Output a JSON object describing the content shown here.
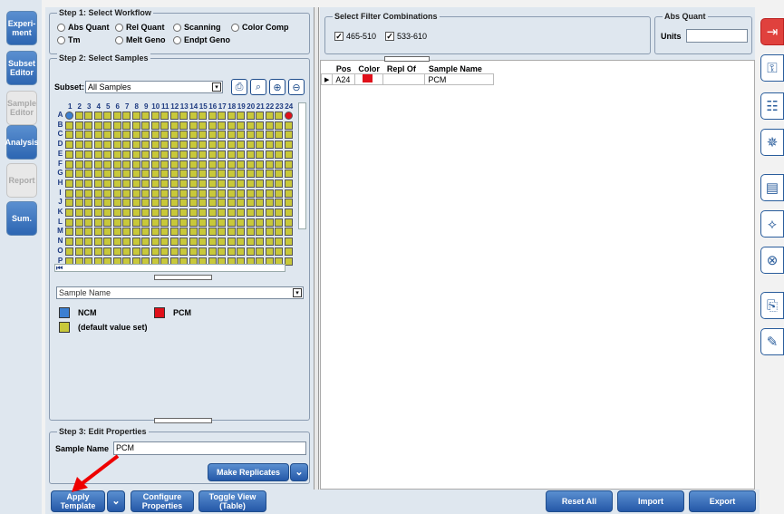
{
  "nav": {
    "experiment": "Experi-\nment",
    "subset_editor": "Subset Editor",
    "sample_editor": "Sample Editor",
    "analysis": "Analysis",
    "report": "Report",
    "summary": "Sum."
  },
  "step1": {
    "title": "Step 1: Select Workflow",
    "options": [
      "Abs Quant",
      "Rel Quant",
      "Scanning",
      "Color Comp",
      "Tm",
      "Melt Geno",
      "Endpt Geno"
    ]
  },
  "filters": {
    "title": "Select Filter Combinations",
    "items": [
      "465-510",
      "533-610"
    ]
  },
  "absquant": {
    "title": "Abs Quant",
    "units_label": "Units",
    "units_value": ""
  },
  "step2": {
    "title": "Step 2: Select Samples",
    "subset_label": "Subset:",
    "subset_value": "All Samples",
    "rows": [
      "A",
      "B",
      "C",
      "D",
      "E",
      "F",
      "G",
      "H",
      "I",
      "J",
      "K",
      "L",
      "M",
      "N",
      "O",
      "P"
    ],
    "cols": [
      "1",
      "2",
      "3",
      "4",
      "5",
      "6",
      "7",
      "8",
      "9",
      "10",
      "11",
      "12",
      "13",
      "14",
      "15",
      "16",
      "17",
      "18",
      "19",
      "20",
      "21",
      "22",
      "23",
      "24"
    ],
    "property_select": "Sample Name",
    "legend": [
      {
        "label": "NCM",
        "color": "#3b7fd1"
      },
      {
        "label": "PCM",
        "color": "#e0101a"
      },
      {
        "label": "(default value set)",
        "color": "#c8c83a"
      }
    ]
  },
  "table": {
    "headers": [
      "Pos",
      "Color",
      "Repl Of",
      "Sample Name"
    ],
    "rows": [
      {
        "pos": "A24",
        "color": "#e0101a",
        "repl_of": "",
        "sample_name": "PCM"
      }
    ]
  },
  "step3": {
    "title": "Step 3: Edit Properties",
    "sample_name_label": "Sample Name",
    "sample_name_value": "PCM",
    "make_replicates": "Make Replicates"
  },
  "bottom": {
    "apply_template": "Apply\nTemplate",
    "configure_properties": "Configure\nProperties",
    "toggle_view": "Toggle View\n(Table)",
    "reset_all": "Reset All",
    "import": "Import",
    "export": "Export"
  },
  "colors": {
    "accent": "#2d66b2",
    "panel": "#dfe7ef",
    "well_default": "#c8c83a"
  }
}
